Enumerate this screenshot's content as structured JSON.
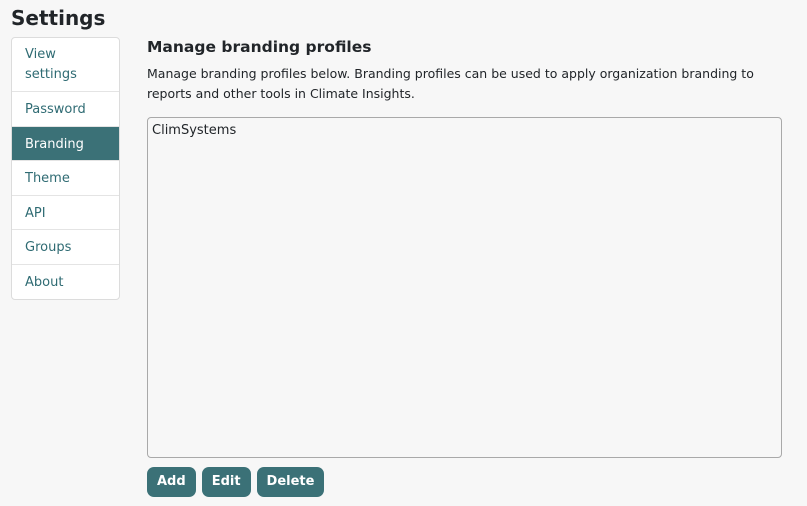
{
  "page": {
    "title": "Settings"
  },
  "sidebar": {
    "items": [
      {
        "label": "View settings",
        "active": false
      },
      {
        "label": "Password",
        "active": false
      },
      {
        "label": "Branding",
        "active": true
      },
      {
        "label": "Theme",
        "active": false
      },
      {
        "label": "API",
        "active": false
      },
      {
        "label": "Groups",
        "active": false
      },
      {
        "label": "About",
        "active": false
      }
    ]
  },
  "main": {
    "section_title": "Manage branding profiles",
    "description": "Manage branding profiles below. Branding profiles can be used to apply organization branding to reports and other tools in Climate Insights.",
    "profiles": [
      "ClimSystems"
    ],
    "buttons": {
      "add": "Add",
      "edit": "Edit",
      "delete": "Delete"
    }
  },
  "colors": {
    "accent": "#3b7177",
    "link": "#2f6b73",
    "background": "#f7f7f7"
  }
}
